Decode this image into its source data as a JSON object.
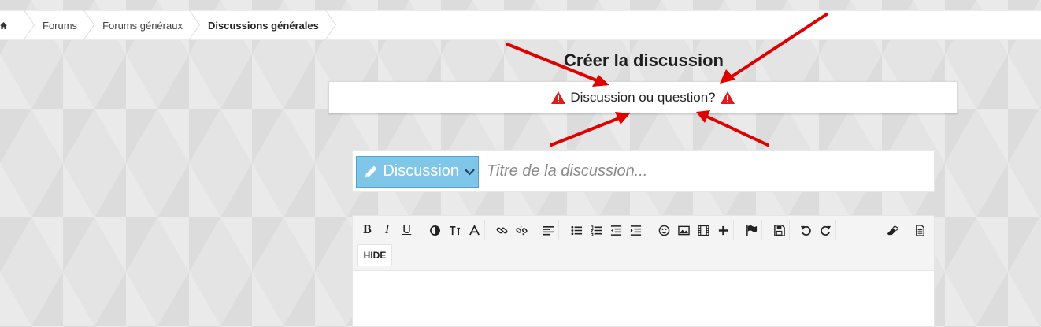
{
  "breadcrumb": {
    "items": [
      "Forums",
      "Forums généraux",
      "Discussions générales"
    ]
  },
  "page": {
    "title": "Créer la discussion",
    "notice": "Discussion ou question?"
  },
  "thread_title": {
    "prefix_label": "Discussion",
    "placeholder": "Titre de la discussion..."
  },
  "editor": {
    "hide_label": "HIDE"
  },
  "colors": {
    "prefix_bg": "#7fc6e8",
    "warning": "#e01b1b",
    "arrow": "#e00000"
  },
  "icons": [
    "home-icon",
    "warning-icon",
    "pencil-icon",
    "chevron-down-icon",
    "bold-icon",
    "italic-icon",
    "underline-icon",
    "color-icon",
    "font-size-icon",
    "font-family-icon",
    "link-icon",
    "unlink-icon",
    "align-icon",
    "bullet-list-icon",
    "numbered-list-icon",
    "outdent-icon",
    "indent-icon",
    "smiley-icon",
    "image-icon",
    "media-icon",
    "insert-icon",
    "flag-icon",
    "save-icon",
    "undo-icon",
    "redo-icon",
    "eraser-icon",
    "bbcode-icon"
  ]
}
